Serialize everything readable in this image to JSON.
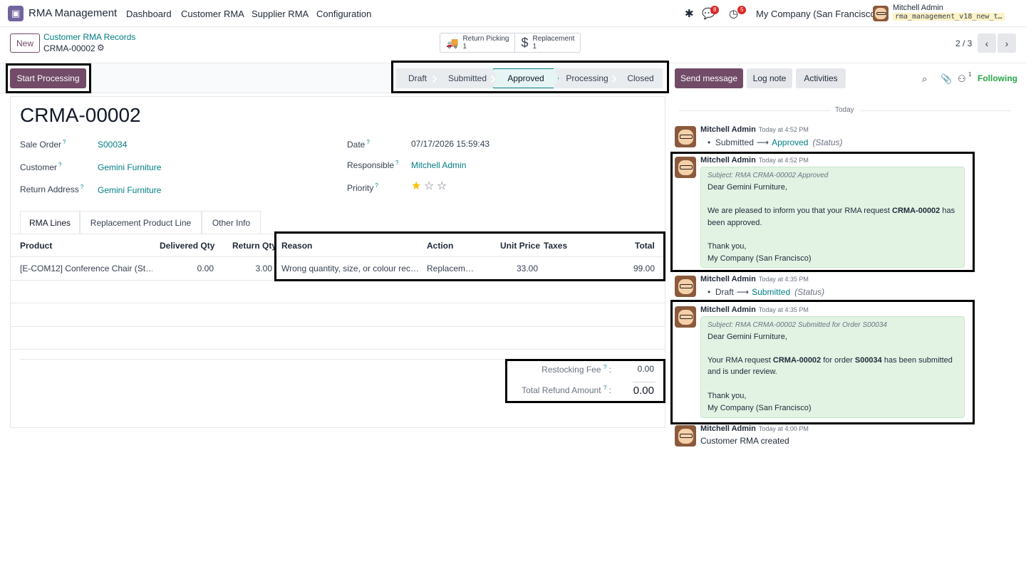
{
  "navbar": {
    "app_name": "RMA Management",
    "menu": [
      "Dashboard",
      "Customer RMA",
      "Supplier RMA",
      "Configuration"
    ],
    "messages_badge": "8",
    "activities_badge": "5",
    "company": "My Company (San Francisco)",
    "user_name": "Mitchell Admin",
    "db_name": "rma_management_v18_new_t…"
  },
  "control": {
    "new_label": "New",
    "breadcrumb_parent": "Customer RMA Records",
    "breadcrumb_current": "CRMA-00002",
    "smart_buttons": [
      {
        "label": "Return Picking",
        "count": "1",
        "icon": "truck-icon"
      },
      {
        "label": "Replacement",
        "count": "1",
        "icon": "dollar-icon"
      }
    ],
    "pager": "2 / 3"
  },
  "statusbar": {
    "action_label": "Start Processing",
    "stages": [
      "Draft",
      "Submitted",
      "Approved",
      "Processing",
      "Closed"
    ],
    "active_stage": "Approved"
  },
  "form": {
    "title": "CRMA-00002",
    "fields": {
      "sale_order": {
        "label": "Sale Order",
        "value": "S00034"
      },
      "customer": {
        "label": "Customer",
        "value": "Gemini Furniture"
      },
      "return_address": {
        "label": "Return Address",
        "value": "Gemini Furniture"
      },
      "date": {
        "label": "Date",
        "value": "07/17/2026 15:59:43"
      },
      "responsible": {
        "label": "Responsible",
        "value": "Mitchell Admin"
      },
      "priority": {
        "label": "Priority",
        "value": 1,
        "max": 3
      }
    },
    "tabs": [
      "RMA Lines",
      "Replacement Product Line",
      "Other Info"
    ],
    "table": {
      "headers": [
        "Product",
        "Delivered Qty",
        "Return Qty",
        "Reason",
        "Action",
        "Unit Price",
        "Taxes",
        "Total"
      ],
      "rows": [
        [
          "[E-COM12] Conference Chair (St…",
          "0.00",
          "3.00",
          "Wrong quantity, size, or colour rec…",
          "Replacem…",
          "33.00",
          "",
          "99.00"
        ]
      ]
    },
    "totals": {
      "restocking_label": "Restocking Fee",
      "restocking_value": "0.00",
      "refund_label": "Total Refund Amount",
      "refund_value": "0.00"
    }
  },
  "chatter": {
    "send_message": "Send message",
    "log_note": "Log note",
    "activities": "Activities",
    "followers_count": "1",
    "following": "Following",
    "today": "Today",
    "messages": [
      {
        "author": "Mitchell Admin",
        "time": "Today at 4:52 PM",
        "old": "Submitted",
        "new": "Approved",
        "field": "(Status)"
      },
      {
        "author": "Mitchell Admin",
        "time": "Today at 4:52 PM",
        "subject": "Subject: RMA CRMA-00002 Approved",
        "greeting": "Dear Gemini Furniture,",
        "line1_a": "We are pleased to inform you that your RMA request ",
        "line1_b": "CRMA-00002",
        "line1_c": " has",
        "line2": "been approved.",
        "thanks": "Thank you,",
        "sign": "My Company (San Francisco)"
      },
      {
        "author": "Mitchell Admin",
        "time": "Today at 4:35 PM",
        "old": "Draft",
        "new": "Submitted",
        "field": "(Status)"
      },
      {
        "author": "Mitchell Admin",
        "time": "Today at 4:35 PM",
        "subject": "Subject: RMA CRMA-00002 Submitted for Order S00034",
        "greeting": "Dear Gemini Furniture,",
        "line1_a": "Your RMA request ",
        "line1_b": "CRMA-00002",
        "line1_c": " for order ",
        "line1_d": "S00034",
        "line1_e": " has been submitted",
        "line2": "and is under review.",
        "thanks": "Thank you,",
        "sign": "My Company (San Francisco)"
      },
      {
        "author": "Mitchell Admin",
        "time": "Today at 4:00 PM",
        "body": "Customer RMA created"
      }
    ]
  },
  "colors": {
    "primary": "#714b67",
    "link": "#017e84",
    "following": "#28a745",
    "bubble": "#e2f3e4"
  }
}
